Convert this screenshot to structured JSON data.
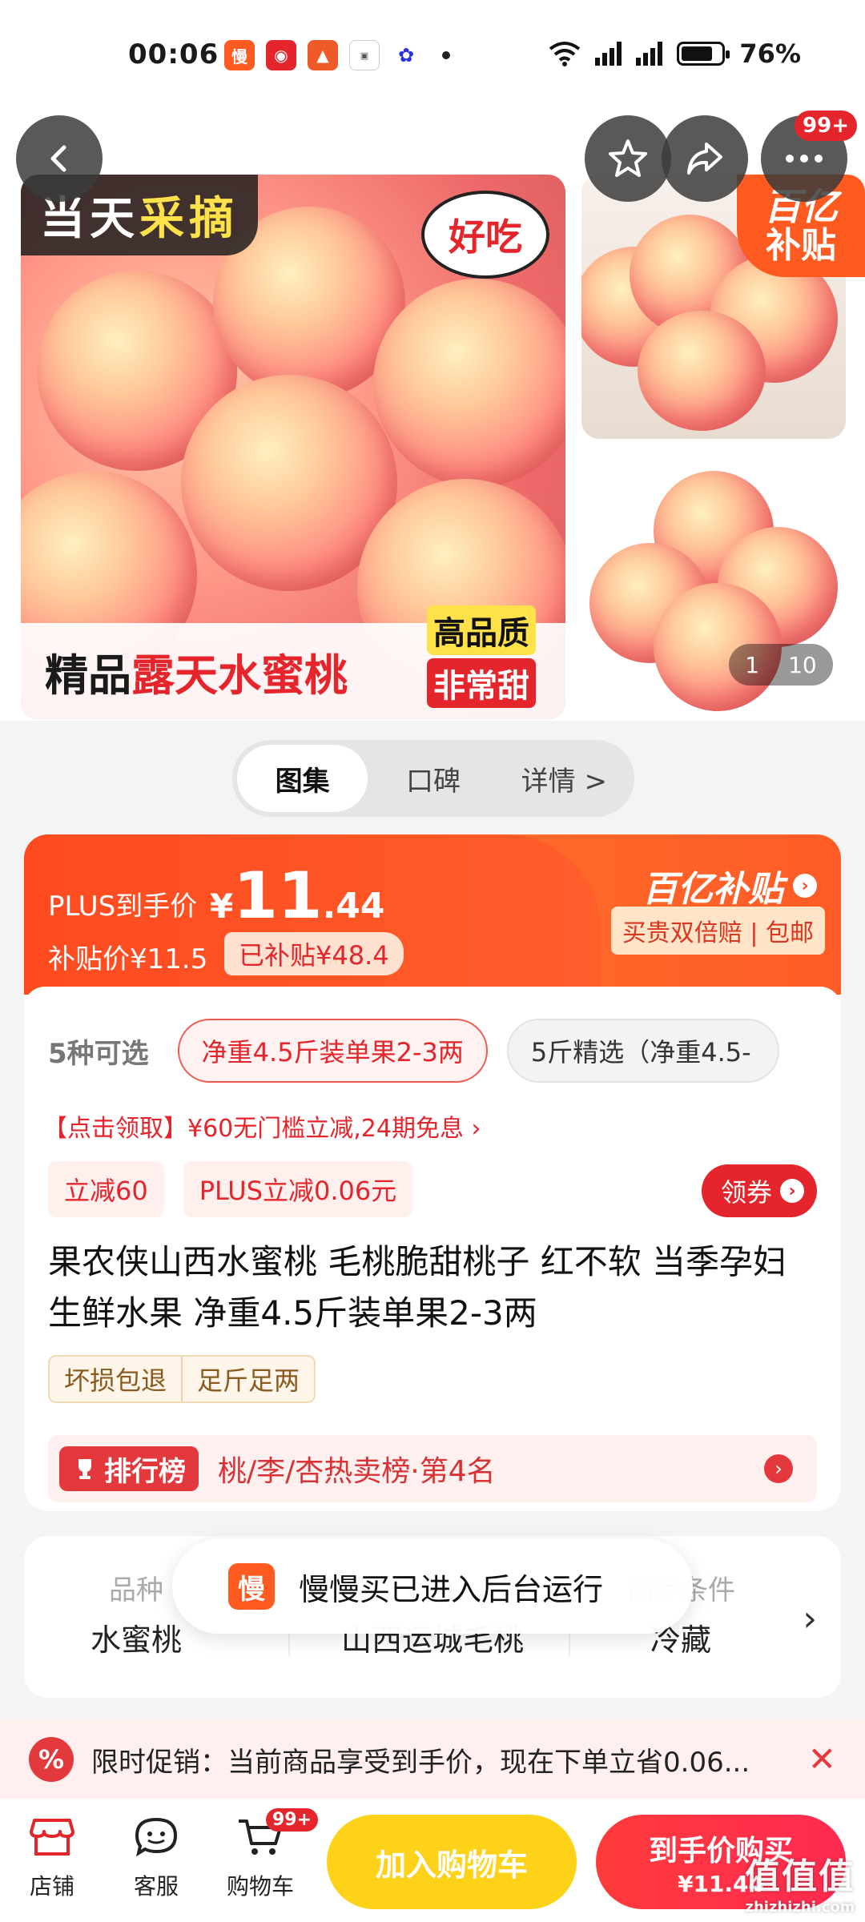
{
  "status_bar": {
    "time": "00:06",
    "battery": "76%",
    "network1": "5G",
    "network2": "5G",
    "app_icons": [
      "慢",
      "bot",
      "duck",
      "realme",
      "baidu"
    ]
  },
  "gallery": {
    "main_tag_left": "当天",
    "main_tag_right": "采摘",
    "burst_tag": "好吃",
    "bottom_tag_left": "精品",
    "bottom_tag_right": "露天水蜜桃",
    "quality_line1": "高品质",
    "quality_line2": "非常甜",
    "subsidy_badge_1": "百亿",
    "subsidy_badge_2": "补贴",
    "current_index": "1",
    "total": "10",
    "notification_badge": "99+"
  },
  "tabs": [
    "图集",
    "口碑",
    "详情 >"
  ],
  "price": {
    "plus_label": "PLUS到手价",
    "yen": "¥",
    "integer": "11",
    "decimal": ".44",
    "subsidy_price": "补贴价¥11.5",
    "subsidized": "已补贴¥48.4",
    "brand": "百亿补贴",
    "guarantee": "买贵双倍赔 | 包邮"
  },
  "specs": {
    "count": "5种可选",
    "options": [
      "净重4.5斤装单果2-3两",
      "5斤精选（净重4.5-"
    ]
  },
  "promo_line": "【点击领取】¥60无门槛立减,24期免息 ›",
  "coupons": [
    "立减60",
    "PLUS立减0.06元"
  ],
  "get_coupon": "领券",
  "product_title": "果农侠山西水蜜桃 毛桃脆甜桃子 红不软 当季孕妇生鲜水果 净重4.5斤装单果2-3两",
  "service_tags": [
    "坏损包退",
    "足斤足两"
  ],
  "rank": {
    "badge": "排行榜",
    "text": "桃/李/杏热卖榜·第4名"
  },
  "attributes": [
    {
      "key": "品种",
      "value": "水蜜桃"
    },
    {
      "key": "产地",
      "value": "山西运城毛桃"
    },
    {
      "key": "储存条件",
      "value": "冷藏"
    }
  ],
  "toast": {
    "icon": "慢",
    "text": "慢慢买已进入后台运行"
  },
  "promo_banner": {
    "text": "限时促销：当前商品享受到手价，现在下单立省0.06..."
  },
  "bottom_bar": {
    "store": "店铺",
    "service": "客服",
    "cart": "购物车",
    "cart_badge": "99+",
    "add_to_cart": "加入购物车",
    "buy_line1": "到手价购买",
    "buy_line2": "¥11.44"
  },
  "watermark": {
    "line1": "值值值",
    "line2": "zhizhizhi.com"
  },
  "colors": {
    "brand_red": "#e4252b",
    "subsidy_orange": "#ff4a1e",
    "cart_yellow": "#ffd21a"
  }
}
